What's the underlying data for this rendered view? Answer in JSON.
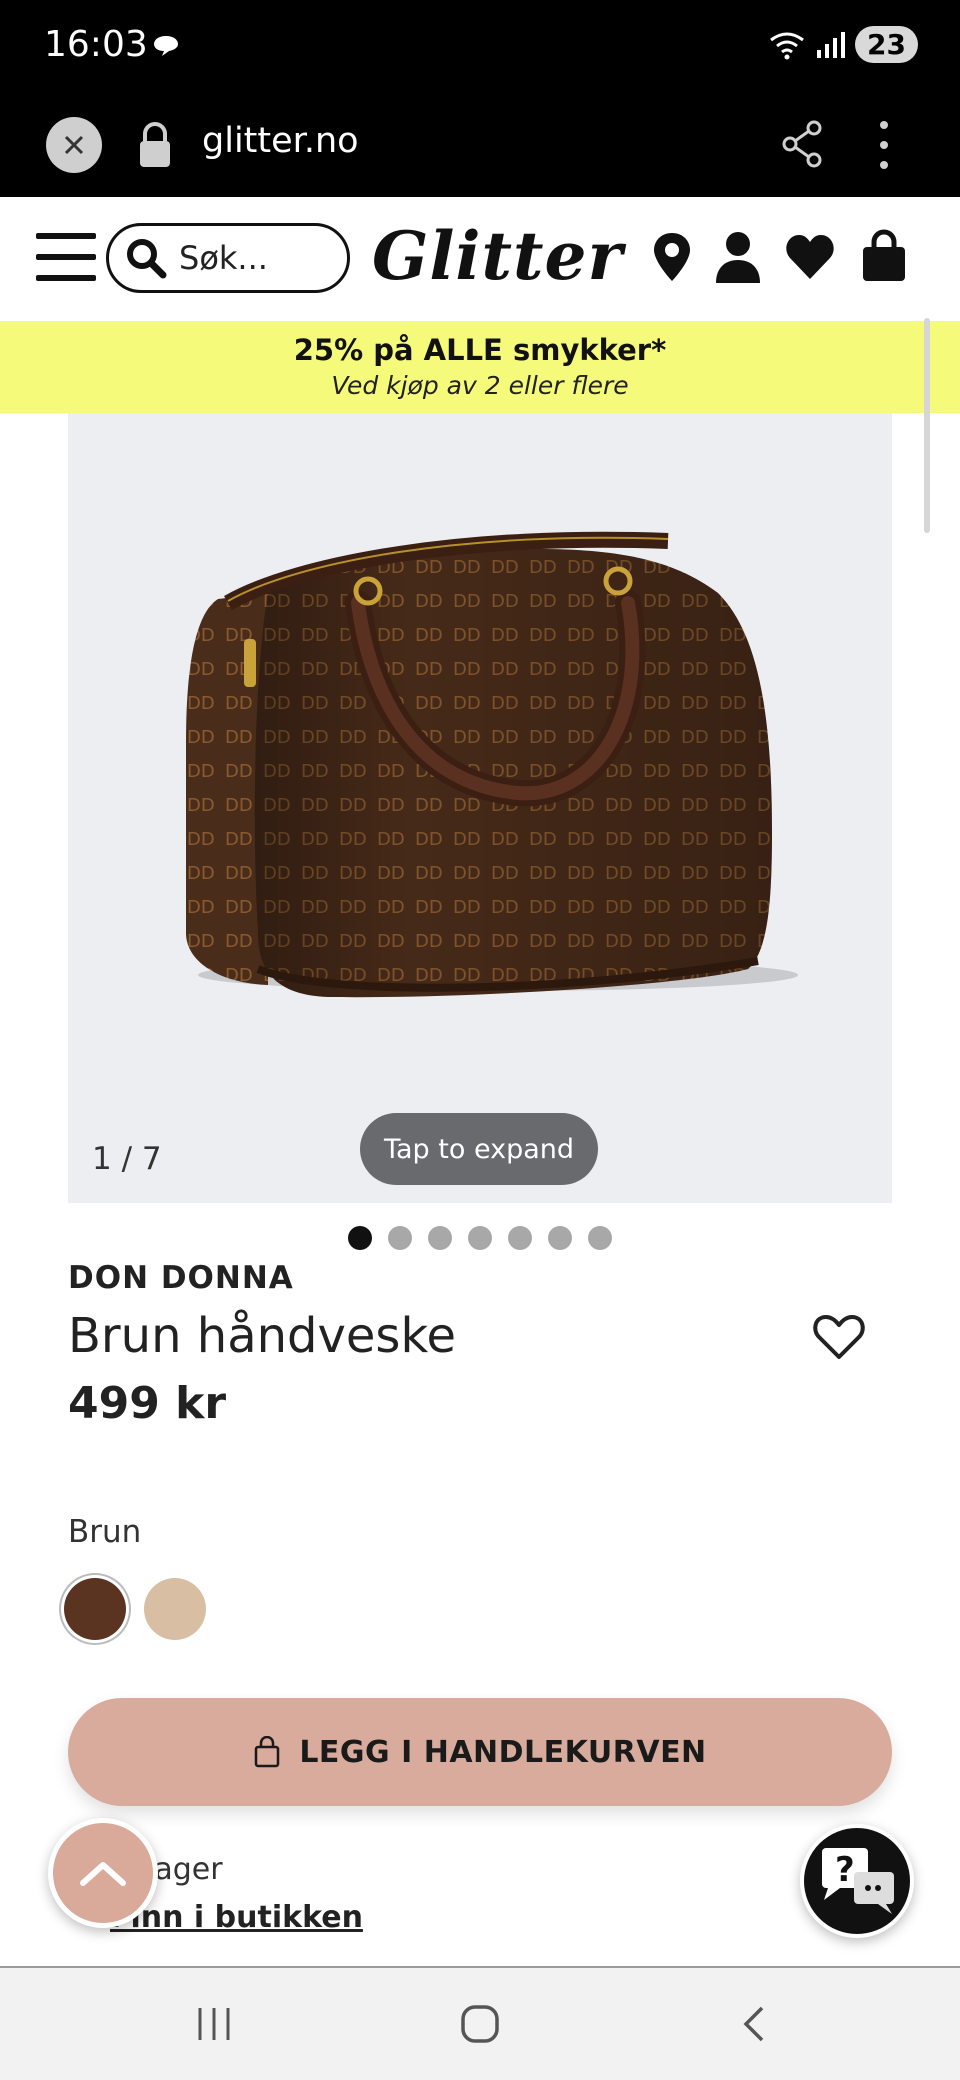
{
  "status_bar": {
    "time": "16:03",
    "battery": "23"
  },
  "browser": {
    "url": "glitter.no"
  },
  "header": {
    "search_placeholder": "Søk...",
    "logo_text": "Glitter"
  },
  "promo": {
    "title": "25% på ALLE smykker*",
    "subtitle": "Ved kjøp av 2 eller flere"
  },
  "gallery": {
    "counter": "1 / 7",
    "expand_label": "Tap to expand",
    "dot_count": 7,
    "active_index": 0
  },
  "product": {
    "brand": "DON DONNA",
    "name": "Brun håndveske",
    "price": "499 kr",
    "color_label": "Brun",
    "swatches": [
      {
        "name": "brown",
        "color": "#5a3420",
        "selected": true
      },
      {
        "name": "beige",
        "color": "#d8bfa3",
        "selected": false
      }
    ],
    "add_to_cart": "LEGG I HANDLEKURVEN",
    "stock_text": "lager",
    "store_link": "Finn i butikken"
  },
  "colors": {
    "promo_bg": "#f6fa7a",
    "cart_button": "#d8ab9c",
    "image_bg": "#eceef1"
  }
}
